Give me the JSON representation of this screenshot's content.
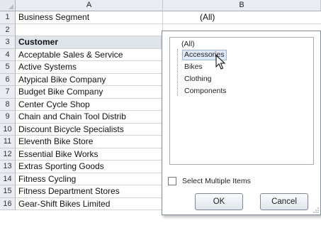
{
  "columns": [
    "A",
    "B"
  ],
  "rows": [
    {
      "num": "1",
      "a": "Business Segment",
      "b": "(All)"
    },
    {
      "num": "2",
      "a": "",
      "b": ""
    },
    {
      "num": "3",
      "a": "Customer",
      "b": ""
    },
    {
      "num": "4",
      "a": "Acceptable Sales & Service",
      "b": ""
    },
    {
      "num": "5",
      "a": "Active Systems",
      "b": ""
    },
    {
      "num": "6",
      "a": "Atypical Bike Company",
      "b": ""
    },
    {
      "num": "7",
      "a": "Budget Bike Company",
      "b": ""
    },
    {
      "num": "8",
      "a": "Center Cycle Shop",
      "b": ""
    },
    {
      "num": "9",
      "a": "Chain and Chain Tool Distrib",
      "b": ""
    },
    {
      "num": "10",
      "a": "Discount Bicycle Specialists",
      "b": ""
    },
    {
      "num": "11",
      "a": "Eleventh Bike Store",
      "b": ""
    },
    {
      "num": "12",
      "a": "Essential Bike Works",
      "b": ""
    },
    {
      "num": "13",
      "a": "Extras Sporting Goods",
      "b": ""
    },
    {
      "num": "14",
      "a": "Fitness Cycling",
      "b": ""
    },
    {
      "num": "15",
      "a": "Fitness Department Stores",
      "b": ""
    },
    {
      "num": "16",
      "a": "Gear-Shift Bikes Limited",
      "b": ""
    }
  ],
  "filter_popup": {
    "items": [
      "(All)",
      "Accessories",
      "Bikes",
      "Clothing",
      "Components"
    ],
    "selected_item": "Accessories",
    "select_multiple_label": "Select Multiple Items",
    "select_multiple_checked": false,
    "ok_label": "OK",
    "cancel_label": "Cancel"
  },
  "icons": {
    "dropdown": "chevron-down-icon",
    "cursor": "mouse-pointer-icon",
    "resize": "resize-grip-icon"
  },
  "colors": {
    "header_bg": "#e9ecf1",
    "shaded_row": "#dfe3ea",
    "selection_bg": "#dfe8f5"
  }
}
